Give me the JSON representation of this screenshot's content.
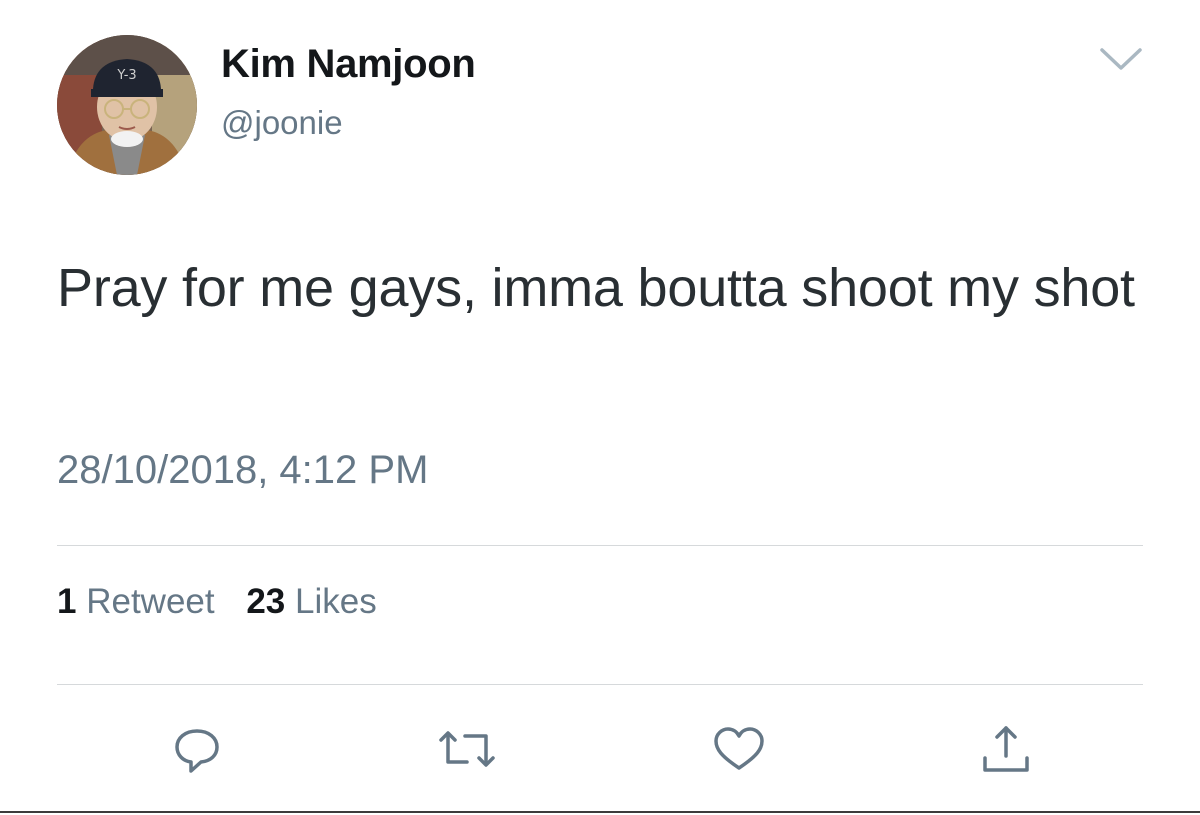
{
  "author": {
    "display_name": "Kim Namjoon",
    "handle": "@joonie"
  },
  "tweet": {
    "text": "Pray for me gays, imma boutta shoot my shot",
    "timestamp": "28/10/2018, 4:12 PM"
  },
  "stats": {
    "retweets_count": "1",
    "retweets_label": "Retweet",
    "likes_count": "23",
    "likes_label": "Likes"
  },
  "icons": {
    "menu": "chevron-down-icon",
    "reply": "reply-icon",
    "retweet": "retweet-icon",
    "like": "heart-icon",
    "share": "share-icon"
  },
  "colors": {
    "primary_text": "#14171a",
    "secondary_text": "#657786",
    "icon": "#657786",
    "divider": "#d6d9db"
  }
}
